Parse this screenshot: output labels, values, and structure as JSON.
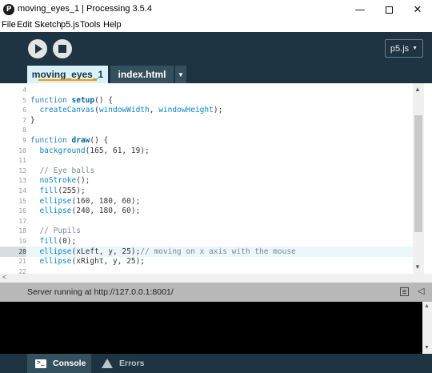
{
  "window": {
    "title": "moving_eyes_1 | Processing 3.5.4",
    "minimize_glyph": "—",
    "close_glyph": "✕"
  },
  "menu": [
    "File",
    "Edit",
    "Sketch",
    "p5.js",
    "Tools",
    "Help"
  ],
  "toolbar": {
    "mode_label": "p5.js",
    "mode_arrow": "▼"
  },
  "tabs": {
    "active_label": "moving_eyes_1",
    "second_label": "index.html",
    "menu_glyph": "▼"
  },
  "editor": {
    "active_line": "20",
    "lines": [
      {
        "n": "4",
        "code": ""
      },
      {
        "n": "5",
        "code": "function setup() {"
      },
      {
        "n": "6",
        "code": "  createCanvas(windowWidth, windowHeight);"
      },
      {
        "n": "7",
        "code": "}"
      },
      {
        "n": "8",
        "code": ""
      },
      {
        "n": "9",
        "code": "function draw() {"
      },
      {
        "n": "10",
        "code": "  background(165, 61, 19);"
      },
      {
        "n": "11",
        "code": ""
      },
      {
        "n": "12",
        "code": "  // Eye balls"
      },
      {
        "n": "13",
        "code": "  noStroke();"
      },
      {
        "n": "14",
        "code": "  fill(255);"
      },
      {
        "n": "15",
        "code": "  ellipse(160, 180, 60);"
      },
      {
        "n": "16",
        "code": "  ellipse(240, 180, 60);"
      },
      {
        "n": "17",
        "code": ""
      },
      {
        "n": "18",
        "code": "  // Pupils"
      },
      {
        "n": "19",
        "code": "  fill(0);"
      },
      {
        "n": "20",
        "code": "  ellipse(xLeft, y, 25);// moving on x axis with the mouse"
      },
      {
        "n": "21",
        "code": "  ellipse(xRight, y, 25);"
      },
      {
        "n": "22",
        "code": ""
      }
    ]
  },
  "status": {
    "message": "Server running at http://127.0.0.1:8001/"
  },
  "footer": {
    "console_label": "Console",
    "errors_label": "Errors"
  },
  "colors": {
    "toolbar_bg": "#1e3443",
    "active_tab_bg": "#d9f1f9",
    "tab_underline": "#ff9a00",
    "status_bg": "#b8b8b8",
    "console_bg": "#000000"
  }
}
